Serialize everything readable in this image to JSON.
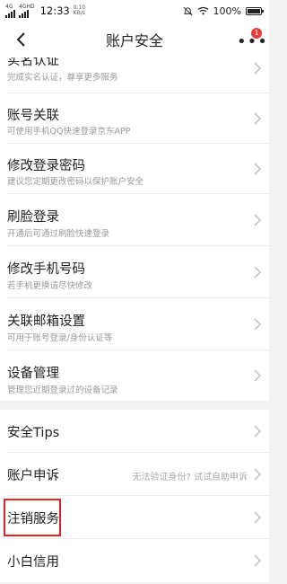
{
  "statusbar": {
    "signal1_label": "4G",
    "signal2_label": "4G",
    "signal2_type": "HD",
    "time": "12:33",
    "speed_value": "0.10",
    "speed_unit": "KB/s",
    "battery_text": "100%",
    "battery_level": 1.0
  },
  "navbar": {
    "title": "账户安全",
    "more_badge": "1"
  },
  "items": [
    {
      "title": "实名认证",
      "subtitle": "完成实名认证，尊享更多服务"
    },
    {
      "title": "账号关联",
      "subtitle": "可使用手机QQ快速登录京东APP"
    },
    {
      "title": "修改登录密码",
      "subtitle": "建议您定期更改密码以保护账户安全"
    },
    {
      "title": "刷脸登录",
      "subtitle": "开通后可通过刷脸快速登录"
    },
    {
      "title": "修改手机号码",
      "subtitle": "若手机更换请尽快修改"
    },
    {
      "title": "关联邮箱设置",
      "subtitle": "可用于账号登录/身份认证等"
    },
    {
      "title": "设备管理",
      "subtitle": "管理您近期登录过的设备记录"
    }
  ],
  "simple_items": [
    {
      "title": "安全Tips",
      "hint": ""
    },
    {
      "title": "账户申诉",
      "hint": "无法验证身份? 试试自助申诉"
    },
    {
      "title": "注销服务",
      "hint": ""
    },
    {
      "title": "小白信用",
      "hint": ""
    }
  ],
  "colors": {
    "highlight": "#e12323",
    "badge": "#e93b3d",
    "background": "#f2f2f2"
  }
}
